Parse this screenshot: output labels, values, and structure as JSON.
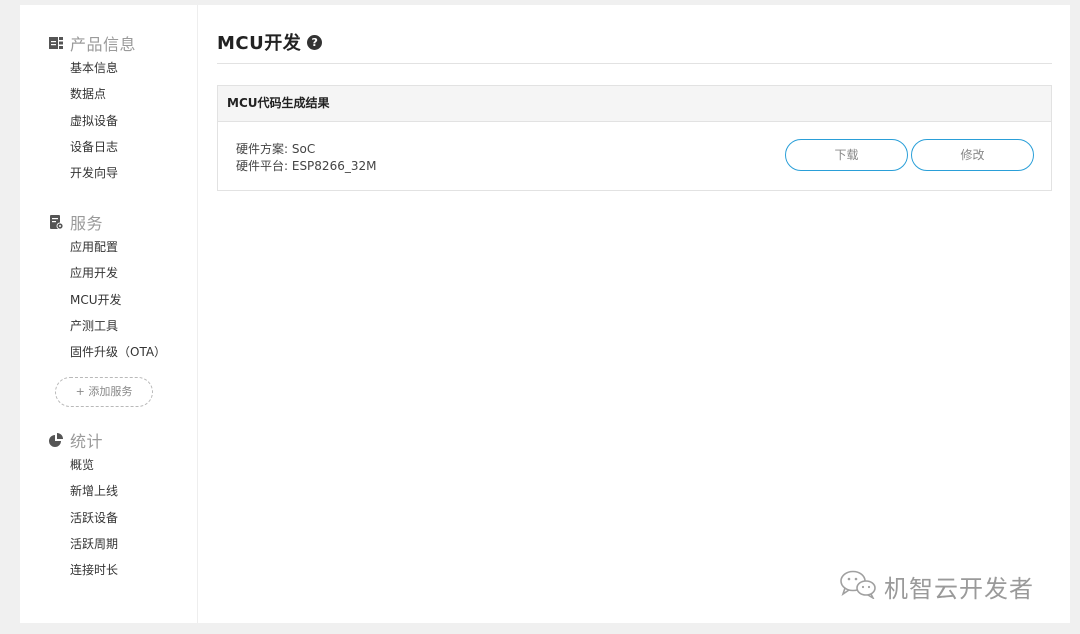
{
  "sidebar": {
    "groups": [
      {
        "title": "产品信息",
        "icon": "grid-icon",
        "items": [
          "基本信息",
          "数据点",
          "虚拟设备",
          "设备日志",
          "开发向导"
        ]
      },
      {
        "title": "服务",
        "icon": "document-gear-icon",
        "items": [
          "应用配置",
          "应用开发",
          "MCU开发",
          "产测工具",
          "固件升级（OTA）"
        ]
      },
      {
        "title": "统计",
        "icon": "pie-chart-icon",
        "items": [
          "概览",
          "新增上线",
          "活跃设备",
          "活跃周期",
          "连接时长"
        ]
      }
    ],
    "add_service_label": "+ 添加服务"
  },
  "main": {
    "title": "MCU开发",
    "help_icon": "question-circle-icon",
    "panel": {
      "title": "MCU代码生成结果",
      "hardware_scheme": "硬件方案: SoC",
      "hardware_platform": "硬件平台: ESP8266_32M",
      "download_label": "下载",
      "modify_label": "修改"
    }
  },
  "watermark": {
    "icon": "wechat-icon",
    "text": "机智云开发者"
  },
  "colors": {
    "button_border": "#2a9fd8",
    "group_title": "#9a9a9a"
  }
}
